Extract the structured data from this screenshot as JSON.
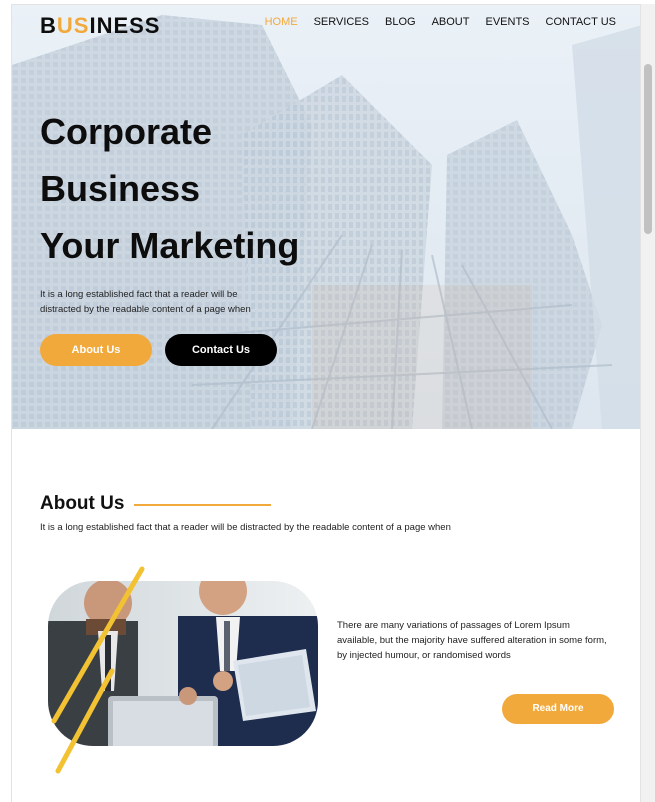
{
  "brand": {
    "logo_b": "B",
    "logo_us": "US",
    "logo_rest": "INESS",
    "accent": "#f2a93b"
  },
  "nav": {
    "items": [
      {
        "label": "HOME",
        "active": true
      },
      {
        "label": "SERVICES"
      },
      {
        "label": "BLOG"
      },
      {
        "label": "ABOUT"
      },
      {
        "label": "EVENTS"
      },
      {
        "label": "CONTACT US"
      }
    ]
  },
  "hero": {
    "title_lines": [
      "Corporate",
      "Business",
      "Your Marketing"
    ],
    "text": "It is a long established fact that a reader will be distracted by the readable content of a page when",
    "about_button": "About Us",
    "contact_button": "Contact Us"
  },
  "about": {
    "title": "About Us",
    "subtitle": "It is a long established fact that a reader will be distracted by the readable content of a page when",
    "body": "There are many variations of passages of Lorem Ipsum available, but the majority have suffered alteration in some form, by injected humour, or randomised words",
    "read_more": "Read More"
  }
}
